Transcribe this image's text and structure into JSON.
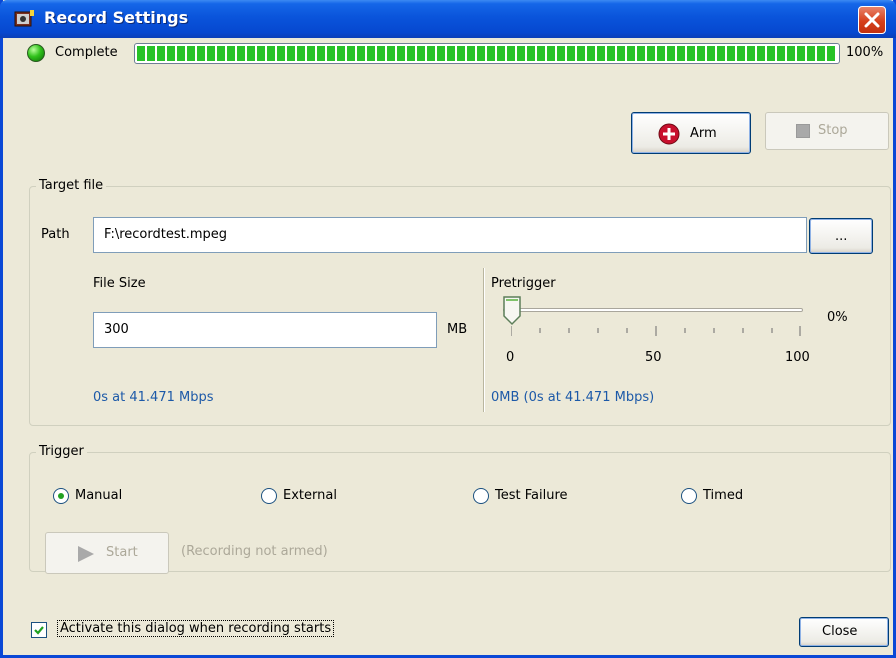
{
  "window": {
    "title": "Record Settings"
  },
  "status": {
    "label": "Complete",
    "progress": 1.0,
    "percent_text": "100%"
  },
  "buttons": {
    "arm": "Arm",
    "stop": "Stop",
    "browse": "...",
    "start": "Start",
    "close": "Close"
  },
  "target": {
    "legend": "Target file",
    "path_label": "Path",
    "path_value": "F:\\recordtest.mpeg",
    "filesize_label": "File Size",
    "filesize_value": "300",
    "filesize_unit": "MB",
    "filesize_info": "0s at 41.471 Mbps",
    "pretrigger_label": "Pretrigger",
    "pretrigger_value": 0,
    "pretrigger_percent": "0%",
    "slider_min": "0",
    "slider_mid": "50",
    "slider_max": "100",
    "pretrigger_info": "0MB (0s at 41.471 Mbps)"
  },
  "trigger": {
    "legend": "Trigger",
    "options": [
      "Manual",
      "External",
      "Test Failure",
      "Timed"
    ],
    "selected": "Manual",
    "armed_status": "(Recording not armed)"
  },
  "activate_checkbox": {
    "label": "Activate this dialog when recording starts",
    "checked": true
  },
  "colors": {
    "titlebar": "#0a54db",
    "accent_blue": "#1c59a8",
    "progress_green": "#27c227",
    "arm_red": "#c8102e"
  }
}
